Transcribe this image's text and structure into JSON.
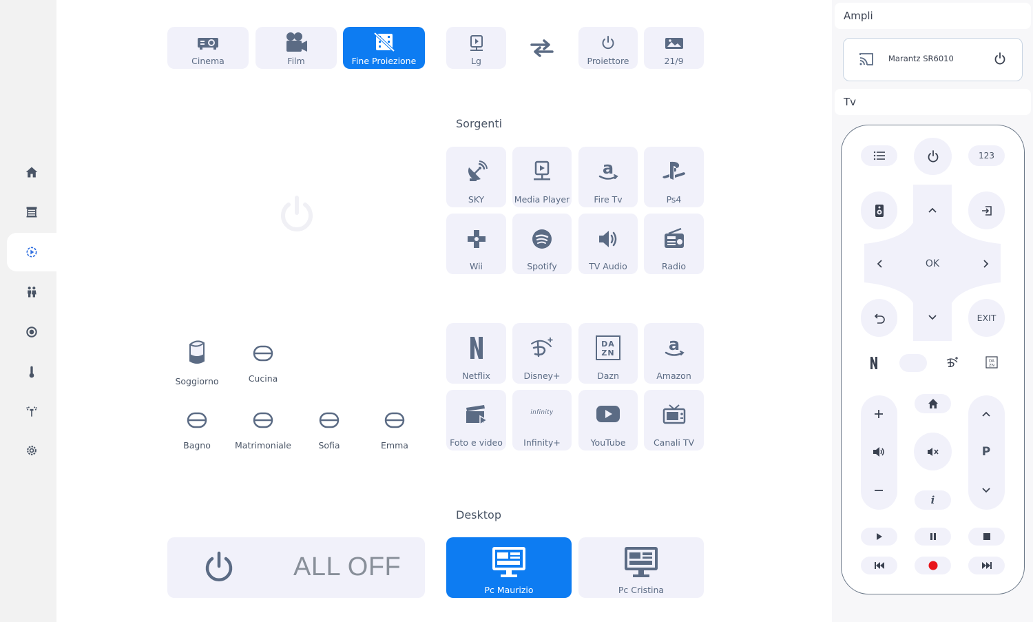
{
  "top_bar": {
    "cinema": "Cinema",
    "film": "Film",
    "fine_proiezione": "Fine Proiezione",
    "lg": "Lg",
    "proiettore": "Proiettore",
    "ratio": "21/9"
  },
  "sorgenti": {
    "title": "Sorgenti",
    "items": [
      "SKY",
      "Media Player",
      "Fire Tv",
      "Ps4",
      "Wii",
      "Spotify",
      "TV Audio",
      "Radio"
    ]
  },
  "apps": {
    "items": [
      "Netflix",
      "Disney+",
      "Dazn",
      "Amazon",
      "Foto e video",
      "Infinity+",
      "YouTube",
      "Canali TV"
    ],
    "infinity_logo_text": "infinity"
  },
  "rooms": {
    "items": [
      "Soggiorno",
      "Cucina",
      "Bagno",
      "Matrimoniale",
      "Sofia",
      "Emma"
    ]
  },
  "desktop": {
    "title": "Desktop",
    "all_off": "ALL OFF",
    "pc_maurizio": "Pc Maurizio",
    "pc_cristina": "Pc Cristina"
  },
  "right_panel": {
    "ampli_title": "Ampli",
    "ampli_device": "Marantz SR6010",
    "tv_title": "Tv",
    "remote": {
      "num_label": "123",
      "ok_label": "OK",
      "exit_label": "EXIT",
      "p_label": "P",
      "info_label": "i",
      "dazn_label": "DA ZN"
    }
  },
  "colors": {
    "accent": "#0d7cf2",
    "tile_bg": "#f1f1fa",
    "icon": "#5b6b84",
    "record": "#e8141a"
  }
}
